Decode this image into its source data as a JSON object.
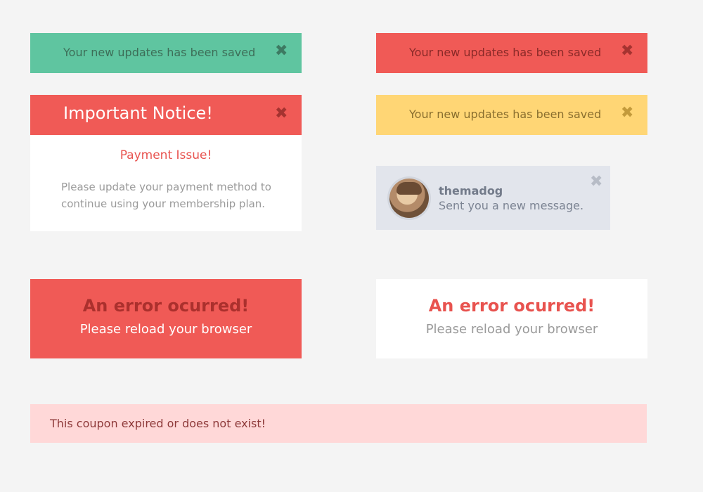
{
  "alerts": {
    "success_green": {
      "message": "Your new updates has been saved",
      "close_symbol": "✖",
      "icon": "close-icon",
      "bg": "#5fc5a0"
    },
    "update_red": {
      "message": "Your new updates has been saved",
      "close_symbol": "✖",
      "icon": "close-icon",
      "bg": "#f05a56"
    },
    "update_yellow": {
      "message": "Your new updates has been saved",
      "close_symbol": "✖",
      "icon": "close-icon",
      "bg": "#ffd675"
    }
  },
  "notice_card": {
    "title": "Important Notice!",
    "close_symbol": "✖",
    "subtitle": "Payment Issue!",
    "body": "Please update your payment method to continue using your membership plan.",
    "header_bg": "#f05a56"
  },
  "message_card": {
    "username": "themadog",
    "text": "Sent you a new message.",
    "close_symbol": "✖",
    "bg": "#e2e5ec"
  },
  "error_blocks": [
    {
      "heading": "An error ocurred!",
      "text": "Please reload your browser",
      "bg": "#f05a56"
    },
    {
      "heading": "An error ocurred!",
      "text": "Please reload your browser",
      "bg": "#ffffff"
    }
  ],
  "coupon_alert": {
    "message": "This coupon expired or does not exist!",
    "bg": "#ffd8d8"
  }
}
